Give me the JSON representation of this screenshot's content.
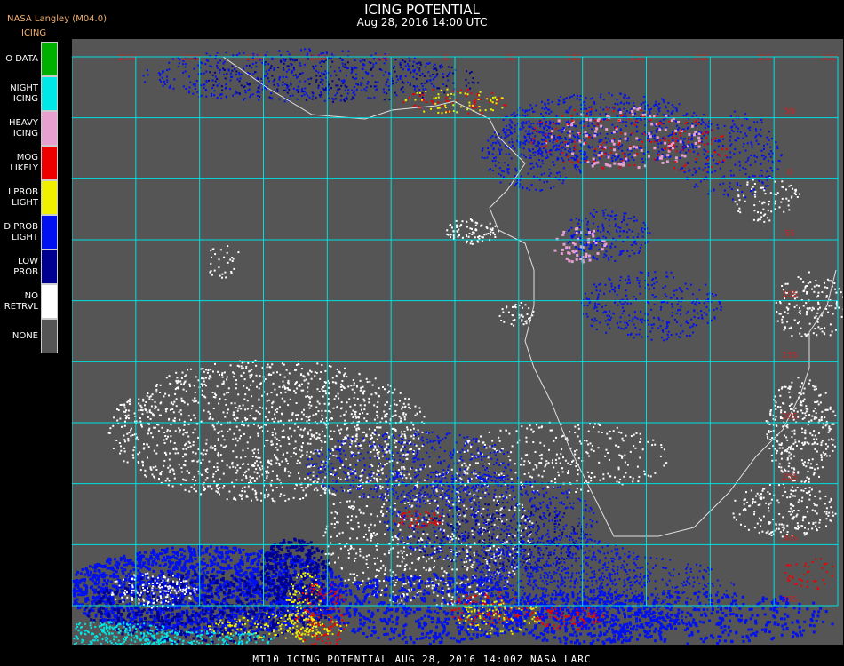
{
  "header": {
    "title": "ICING POTENTIAL",
    "subtitle": "Aug 28, 2016 14:00 UTC",
    "brand": "NASA Langley (M04.0)",
    "legend_heading": "ICING"
  },
  "legend": [
    {
      "lines": [
        "O DATA"
      ],
      "color": "#00b000"
    },
    {
      "lines": [
        "NIGHT",
        "ICING"
      ],
      "color": "#00e8e8"
    },
    {
      "lines": [
        "HEAVY",
        "ICING"
      ],
      "color": "#e8a0d0"
    },
    {
      "lines": [
        "MOG",
        "LIKELY"
      ],
      "color": "#ee0000"
    },
    {
      "lines": [
        "I PROB",
        "LIGHT"
      ],
      "color": "#f0f000"
    },
    {
      "lines": [
        "D PROB",
        "LIGHT"
      ],
      "color": "#0010f0"
    },
    {
      "lines": [
        "LOW",
        "PROB"
      ],
      "color": "#000090"
    },
    {
      "lines": [
        "NO",
        "RETRVL"
      ],
      "color": "#ffffff"
    },
    {
      "lines": [
        "NONE"
      ],
      "color": "#555555"
    }
  ],
  "map": {
    "background_color": "#555555",
    "grid_color": "#00e0e0",
    "coastline_color": "#e0e0e0",
    "lat_labels": [
      "5N",
      "0",
      "5S",
      "10S",
      "15S",
      "20S",
      "25S",
      "30S",
      "35S",
      "40S"
    ],
    "lon_labels": [
      "25W",
      "20W",
      "15W",
      "10W",
      "5W",
      "0",
      "5E",
      "10E",
      "15E",
      "20E",
      "25E",
      "30E",
      "35E"
    ]
  },
  "footer": "MT10  ICING POTENTIAL    AUG 28, 2016 14:00Z   NASA LARC"
}
